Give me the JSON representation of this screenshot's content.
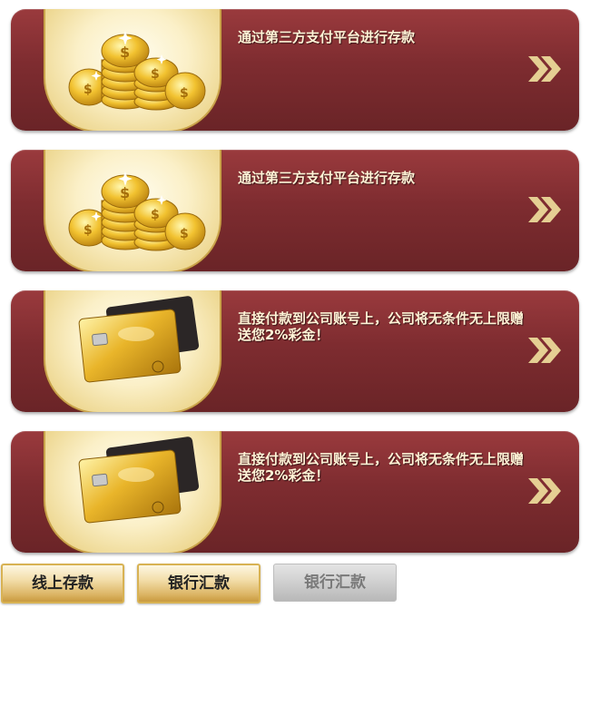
{
  "cards": [
    {
      "icon": "gold-coins-icon",
      "text": "通过第三方支付平台进行存款"
    },
    {
      "icon": "gold-coins-icon",
      "text": "通过第三方支付平台进行存款"
    },
    {
      "icon": "gold-bank-card-icon",
      "text": "直接付款到公司账号上，公司将无条件无上限赠送您2%彩金！"
    },
    {
      "icon": "gold-bank-card-icon",
      "text": "直接付款到公司账号上，公司将无条件无上限赠送您2%彩金！"
    }
  ],
  "tabs": [
    {
      "label": "线上存款",
      "state": "active"
    },
    {
      "label": "银行汇款",
      "state": "active"
    },
    {
      "label": "银行汇款",
      "state": "disabled"
    }
  ],
  "colors": {
    "card": "#7e2c30",
    "badge": "#ecd58c",
    "chevron": "#e5cf93",
    "text": "#fff3d6"
  }
}
